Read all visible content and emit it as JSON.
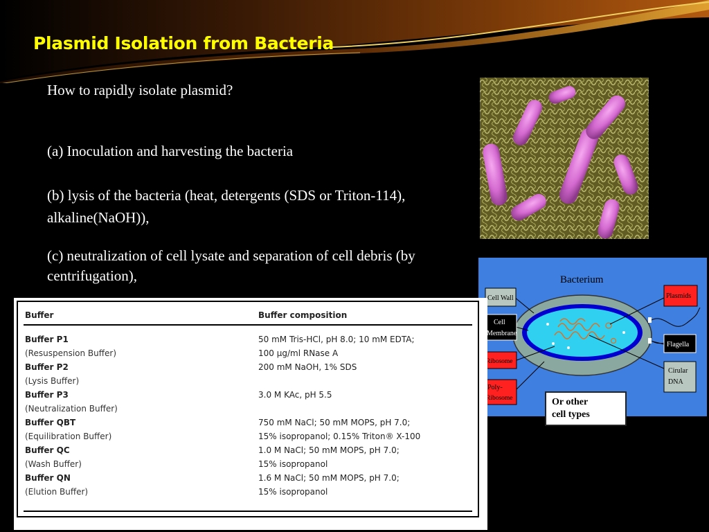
{
  "title": "Plasmid Isolation from Bacteria",
  "question": "How to rapidly isolate plasmid?",
  "steps": {
    "a": "(a) Inoculation and harvesting the bacteria",
    "b": "(b) lysis of the bacteria (heat, detergents (SDS or Triton-114), alkaline(NaOH)),",
    "c": "(c) neutralization of cell lysate and separation of cell debris (by centrifugation),"
  },
  "diagram": {
    "title": "Bacterium",
    "labels": {
      "cell_wall": "Cell Wall",
      "cell_membrane_1": "Cell",
      "cell_membrane_2": "Membrane",
      "ribosome": "Ribosome",
      "poly_ribosome_1": "Poly-",
      "poly_ribosome_2": "Ribosome",
      "plasmids": "Plasmids",
      "flagella": "Flagella",
      "circular_dna_1": "Cirular",
      "circular_dna_2": "DNA"
    },
    "caption_line1": "Or other",
    "caption_line2": "cell types"
  },
  "table": {
    "headers": [
      "Buffer",
      "Buffer composition"
    ],
    "rows": [
      {
        "name": "Buffer P1",
        "sub": "(Resuspension Buffer)",
        "comp": [
          "50 mM Tris-HCl, pH 8.0; 10 mM EDTA;",
          "100 µg/ml RNase A"
        ]
      },
      {
        "name": "Buffer P2",
        "sub": "(Lysis Buffer)",
        "comp": [
          "200 mM NaOH, 1% SDS"
        ]
      },
      {
        "name": "Buffer P3",
        "sub": "(Neutralization Buffer)",
        "comp": [
          "3.0 M KAc, pH 5.5"
        ]
      },
      {
        "name": "Buffer QBT",
        "sub": "(Equilibration Buffer)",
        "comp": [
          "750 mM NaCl; 50 mM MOPS, pH 7.0;",
          "15% isopropanol; 0.15% Triton® X-100"
        ]
      },
      {
        "name": "Buffer QC",
        "sub": "(Wash Buffer)",
        "comp": [
          "1.0 M NaCl; 50 mM MOPS, pH 7.0;",
          "15% isopropanol"
        ]
      },
      {
        "name": "Buffer QN",
        "sub": "(Elution Buffer)",
        "comp": [
          "1.6 M NaCl; 50 mM MOPS, pH 7.0;",
          "15% isopropanol"
        ]
      }
    ]
  },
  "colors": {
    "title": "#ffff00",
    "background": "#000000",
    "diagram_bg": "#3f7fe0",
    "label_red": "#ff2020",
    "label_gray": "#b8c8c0"
  }
}
